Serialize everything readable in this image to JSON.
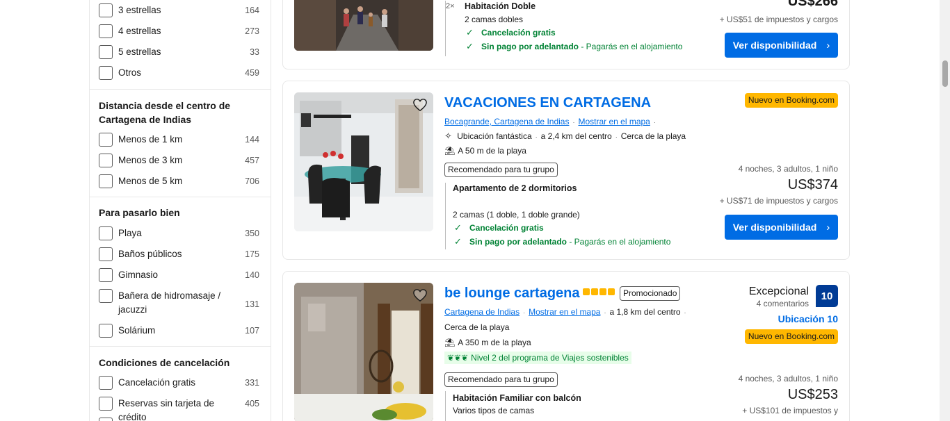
{
  "filters": {
    "stars": [
      {
        "label": "3 estrellas",
        "count": "164"
      },
      {
        "label": "4 estrellas",
        "count": "273"
      },
      {
        "label": "5 estrellas",
        "count": "33"
      },
      {
        "label": "Otros",
        "count": "459"
      }
    ],
    "distance": {
      "title": "Distancia desde el centro de Cartagena de Indias",
      "items": [
        {
          "label": "Menos de 1 km",
          "count": "144"
        },
        {
          "label": "Menos de 3 km",
          "count": "457"
        },
        {
          "label": "Menos de 5 km",
          "count": "706"
        }
      ]
    },
    "fun": {
      "title": "Para pasarlo bien",
      "items": [
        {
          "label": "Playa",
          "count": "350"
        },
        {
          "label": "Baños públicos",
          "count": "175"
        },
        {
          "label": "Gimnasio",
          "count": "140"
        },
        {
          "label": "Bañera de hidromasaje / jacuzzi",
          "count": "131"
        },
        {
          "label": "Solárium",
          "count": "107"
        }
      ]
    },
    "cancel": {
      "title": "Condiciones de cancelación",
      "items": [
        {
          "label": "Cancelación gratis",
          "count": "331"
        },
        {
          "label": "Reservas sin tarjeta de crédito",
          "count": "405"
        }
      ]
    }
  },
  "card1": {
    "room_qty": "2×",
    "room": "Habitación Doble",
    "beds": "2 camas dobles",
    "cancel": "Cancelación gratis",
    "nopay": "Sin pago por adelantado",
    "nopay_note": " - Pagarás en el alojamiento",
    "price": "US$266",
    "taxes": "+ US$51 de impuestos y cargos",
    "button": "Ver disponibilidad"
  },
  "card2": {
    "title": "VACACIONES EN CARTAGENA",
    "new_badge": "Nuevo en Booking.com",
    "location": "Bocagrande, Cartagena de Indias",
    "map": "Mostrar en el mapa",
    "location_score": "Ubicación fantástica",
    "distance": "a 2,4 km del centro",
    "near_beach": "Cerca de la playa",
    "beach": "A 50 m de la playa",
    "recommended": "Recomendado para tu grupo",
    "stay": "4 noches, 3 adultos, 1 niño",
    "room": "Apartamento de 2 dormitorios",
    "price": "US$374",
    "taxes": "+ US$71 de impuestos y cargos",
    "beds": "2 camas (1 doble, 1 doble grande)",
    "cancel": "Cancelación gratis",
    "nopay": "Sin pago por adelantado",
    "nopay_note": " - Pagarás en el alojamiento",
    "button": "Ver disponibilidad"
  },
  "card3": {
    "title": "be lounge cartagena",
    "promoted": "Promocionado",
    "location": "Cartagena de Indias",
    "map": "Mostrar en el mapa",
    "distance": "a 1,8 km del centro",
    "near_beach": "Cerca de la playa",
    "beach": "A 350 m de la playa",
    "sustain": "Nivel 2 del programa de Viajes sostenibles",
    "rating_word": "Excepcional",
    "reviews": "4 comentarios",
    "score": "10",
    "location_score": "Ubicación 10",
    "new_badge": "Nuevo en Booking.com",
    "recommended": "Recomendado para tu grupo",
    "stay": "4 noches, 3 adultos, 1 niño",
    "room": "Habitación Familiar con balcón",
    "price": "US$253",
    "beds": "Varios tipos de camas",
    "taxes": "+ US$101 de impuestos y"
  },
  "colors": {
    "link": "#006ce4",
    "green": "#008234",
    "badge": "#ffb700",
    "score": "#003b95"
  }
}
